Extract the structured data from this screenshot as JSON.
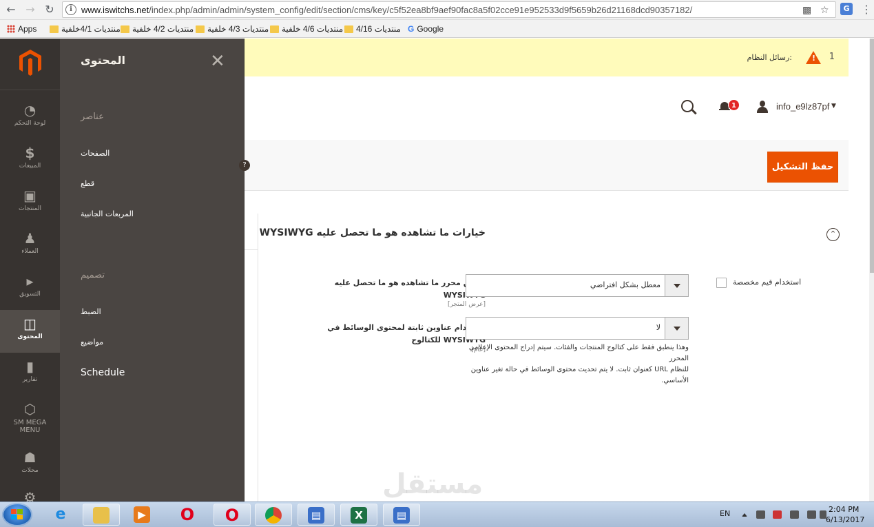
{
  "browser": {
    "url_host": "www.iswitchs.net",
    "url_path": "/index.php/admin/admin/system_config/edit/section/cms/key/c5f52ea8bf9aef90fac8a5f02cce91e952533d9f5659b26d21168dcd90357182/",
    "bookmarks": [
      "Apps",
      "منتديات 4/1خلفية",
      "منتديات 4/2 خلفية",
      "منتديات 4/3 خلفية",
      "منتديات 4/6 خلفية",
      "منتديات 4/16",
      "Google"
    ]
  },
  "admin_nav": {
    "items": [
      {
        "label": "لوحة التحكم",
        "icon": "dashboard-icon"
      },
      {
        "label": "المبيعات",
        "icon": "dollar-icon"
      },
      {
        "label": "المنتجات",
        "icon": "box-icon"
      },
      {
        "label": "العملاء",
        "icon": "person-icon"
      },
      {
        "label": "التسويق",
        "icon": "megaphone-icon"
      },
      {
        "label": "المحتوى",
        "icon": "layout-icon"
      },
      {
        "label": "تقارير",
        "icon": "bar-chart-icon"
      },
      {
        "label": "SM MEGA MENU",
        "icon": "hexagon-icon"
      },
      {
        "label": "محلات",
        "icon": "store-icon"
      }
    ]
  },
  "slide_panel": {
    "title": "المحتوى",
    "group1": "عناصر",
    "group1_links": [
      "الصفحات",
      "قطع",
      "المربعات الجانبية"
    ],
    "group2": "تصميم",
    "group2_links": [
      "الضبط",
      "مواضيع",
      "Schedule"
    ]
  },
  "system_message": {
    "count": "1",
    "label": "رسائل النظام:"
  },
  "header": {
    "notification_count": "1",
    "username": "info_e9lz87pf"
  },
  "actions": {
    "save_label": "حفظ التشكيل"
  },
  "section": {
    "title": "WYSIWYG خيارات ما تشاهده هو ما تحصل عليه"
  },
  "fields": [
    {
      "label_line1": "تمكين محرر ما تشاهده هو ما تحصل عليه",
      "label_line2": "WYSIWYG",
      "scope": "[عرض المتجر]",
      "value": "معطل بشكل افتراضي",
      "use_default_label": "استخدام قيم مخصصة"
    },
    {
      "label_line1": "استخدام عناوين ثابتة لمحتوى الوسائط في",
      "label_line2": "للكتالوج WYSIWYG",
      "scope": "[عام]",
      "value": "لا",
      "note_line1": "وهذا ينطبق فقط على كتالوج المنتجات والفئات. سيتم إدراج المحتوى الإعلامي المحرر",
      "note_line2": "للنظام URL كعنوان ثابت. لا يتم تحديث محتوى الوسائط في حالة تغير عناوين",
      "note_line3": "الأساسي."
    }
  ],
  "watermark": "مستقل",
  "taskbar": {
    "lang": "EN",
    "time": "2:04 PM",
    "date": "6/13/2017"
  }
}
